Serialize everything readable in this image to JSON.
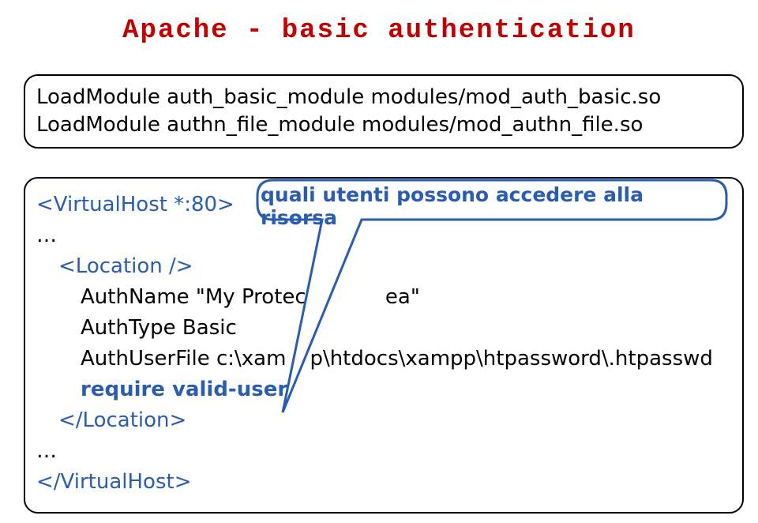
{
  "title": "Apache - basic authentication",
  "code1_line1": "LoadModule auth_basic_module modules/mod_auth_basic.so",
  "code1_line2": "LoadModule authn_file_module modules/mod_authn_file.so",
  "code2": {
    "vhost_open": "<VirtualHost *:80>",
    "ellipsis1": "…",
    "location_open": "<Location />",
    "authname_pre": "AuthName \"My Protect",
    "authname_post": "ea\"",
    "authtype": "AuthType Basic",
    "authuserfile_pre": "AuthUserFile c:\\xam",
    "authuserfile_post": "p\\htdocs\\xampp\\htpassword\\.htpasswd",
    "require": "require valid-user",
    "location_close": "</Location>",
    "ellipsis2": "…",
    "vhost_close": "</VirtualHost>"
  },
  "callout_text": "quali utenti possono accedere alla risorsa"
}
